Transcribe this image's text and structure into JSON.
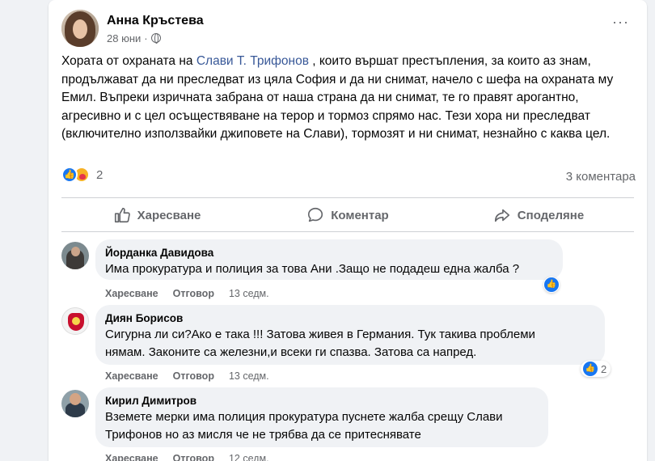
{
  "post": {
    "author": "Анна Кръстева",
    "date": "28 юни",
    "more_icon": "···",
    "text_before_link": "Хората от охраната на ",
    "link_text": "Слави Т. Трифонов",
    "text_after_link": " , които вършат престъпления,  за които аз знам, продължават да ни преследват из цяла София и да ни снимат, начело с шефа на охраната му Емил. Въпреки изричната забрана от наша страна да ни снимат, те го правят арогантно, агресивно и с цел осъществяване на терор и тормоз спрямо нас. Тези хора ни преследват (включително използвайки джиповете на Слави), тормозят и ни снимат, незнайно с каква цел.",
    "reaction_count": "2",
    "comments_count": "3 коментара",
    "like_icon": "👍"
  },
  "actions": {
    "like": "Харесване",
    "comment": "Коментар",
    "share": "Споделяне"
  },
  "comments": [
    {
      "name": "Йорданка Давидова",
      "text": "Има прокуратура и полиция за това Ани .Защо не подадеш една жалба ?",
      "like": "Харесване",
      "reply": "Отговор",
      "time": "13 седм."
    },
    {
      "name": "Диян Борисов",
      "text_line1": "Сигурна ли си?Ако е така !!! Затова живея в Германия. Тук такива проблеми",
      "text_line2": "нямам. Законите са железни,и всеки ги спазва. Затова са напред.",
      "like": "Харесване",
      "reply": "Отговор",
      "time": "13 седм.",
      "reaction_count": "2"
    },
    {
      "name": "Кирил Димитров",
      "text_line1": "Вземете мерки има полиция прокуратура пуснете жалба срещу Слави",
      "text_line2": "Трифонов но аз мисля че не трябва да се притеснявате",
      "like": "Харесване",
      "reply": "Отговор",
      "time": "12 седм."
    }
  ],
  "colors": {
    "accent": "#1877f2",
    "link": "#385898",
    "muted": "#65676b",
    "bubble": "#f0f2f5"
  }
}
